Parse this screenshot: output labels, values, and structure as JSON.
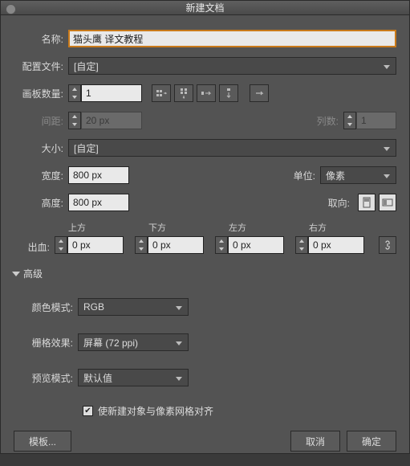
{
  "title": "新建文档",
  "labels": {
    "name": "名称:",
    "profile": "配置文件:",
    "artboards": "画板数量:",
    "spacing": "间距:",
    "columns": "列数:",
    "size": "大小:",
    "width": "宽度:",
    "units": "单位:",
    "height": "高度:",
    "orientation": "取向:",
    "bleed": "出血:",
    "top": "上方",
    "bottom": "下方",
    "left": "左方",
    "right": "右方",
    "advanced": "高级",
    "colorMode": "颜色模式:",
    "rasterEffects": "栅格效果:",
    "previewMode": "预览模式:",
    "alignGrid": "使新建对象与像素网格对齐"
  },
  "values": {
    "name": "猫头鹰 译文教程",
    "profile": "[自定]",
    "artboards": "1",
    "spacing": "20 px",
    "columns": "1",
    "size": "[自定]",
    "width": "800 px",
    "units": "像素",
    "height": "800 px",
    "bleedTop": "0 px",
    "bleedBottom": "0 px",
    "bleedLeft": "0 px",
    "bleedRight": "0 px",
    "colorMode": "RGB",
    "rasterEffects": "屏幕 (72 ppi)",
    "previewMode": "默认值",
    "alignGridChecked": true
  },
  "buttons": {
    "templates": "模板...",
    "cancel": "取消",
    "ok": "确定"
  }
}
